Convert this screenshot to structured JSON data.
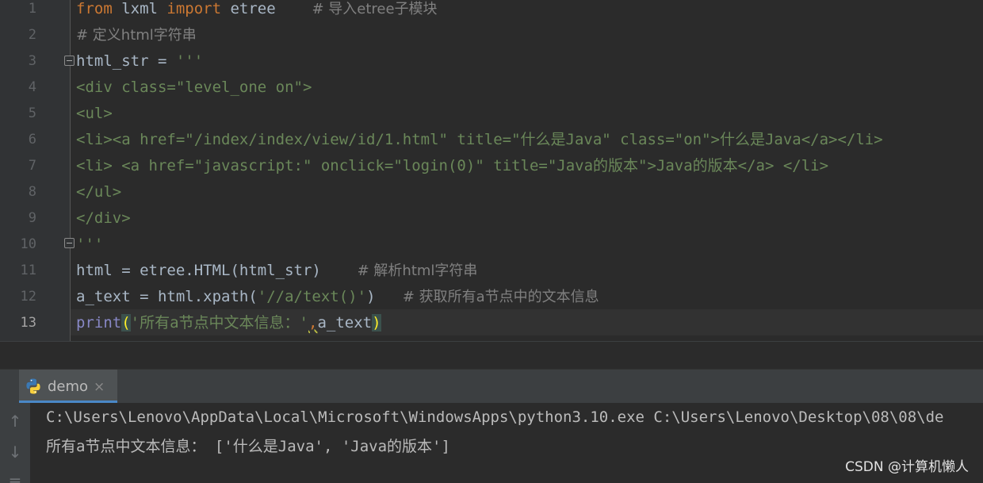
{
  "editor": {
    "line_numbers": [
      "1",
      "2",
      "3",
      "4",
      "5",
      "6",
      "7",
      "8",
      "9",
      "10",
      "11",
      "12",
      "13"
    ],
    "lines": [
      {
        "segments": [
          {
            "cls": "kw",
            "text": "from"
          },
          {
            "cls": "",
            "text": " lxml "
          },
          {
            "cls": "kw",
            "text": "import"
          },
          {
            "cls": "",
            "text": " etree    "
          },
          {
            "cls": "cmt",
            "text": "# 导入etree子模块"
          }
        ]
      },
      {
        "segments": [
          {
            "cls": "cmt",
            "text": "# 定义html字符串"
          }
        ]
      },
      {
        "segments": [
          {
            "cls": "",
            "text": "html_str = "
          },
          {
            "cls": "str",
            "text": "'''"
          }
        ]
      },
      {
        "segments": [
          {
            "cls": "str",
            "text": "<div class=\"level_one on\">"
          }
        ]
      },
      {
        "segments": [
          {
            "cls": "str",
            "text": "<ul>"
          }
        ]
      },
      {
        "segments": [
          {
            "cls": "str",
            "text": "<li><a href=\"/index/index/view/id/1.html\" title=\"什么是Java\" class=\"on\">什么是Java</a></li>"
          }
        ]
      },
      {
        "segments": [
          {
            "cls": "str",
            "text": "<li> <a href=\"javascript:\" onclick=\"login(0)\" title=\"Java的版本\">Java的版本</a> </li>"
          }
        ]
      },
      {
        "segments": [
          {
            "cls": "str",
            "text": "</ul>"
          }
        ]
      },
      {
        "segments": [
          {
            "cls": "str",
            "text": "</div>"
          }
        ]
      },
      {
        "segments": [
          {
            "cls": "str",
            "text": "'''"
          }
        ]
      },
      {
        "segments": [
          {
            "cls": "",
            "text": "html = etree.HTML(html_str)    "
          },
          {
            "cls": "cmt",
            "text": "# 解析html字符串"
          }
        ]
      },
      {
        "segments": [
          {
            "cls": "",
            "text": "a_text = html.xpath("
          },
          {
            "cls": "str",
            "text": "'//a/text()'"
          },
          {
            "cls": "",
            "text": ")   "
          },
          {
            "cls": "cmt",
            "text": "# 获取所有a节点中的文本信息"
          }
        ]
      },
      {
        "segments": [
          {
            "cls": "fn",
            "text": "print"
          },
          {
            "cls": "bracket",
            "text": "("
          },
          {
            "cls": "str",
            "text": "'所有a节点中文本信息：'"
          },
          {
            "cls": "squiggle",
            "text": ","
          },
          {
            "cls": "",
            "text": "a_text"
          },
          {
            "cls": "bracket",
            "text": ")"
          }
        ]
      }
    ],
    "current_line": "13"
  },
  "run_panel": {
    "tab_label": "demo",
    "close_glyph": "×",
    "python_icon": "python-icon",
    "toolbar": [
      {
        "name": "arrow-up-icon",
        "glyph": "↑"
      },
      {
        "name": "arrow-down-icon",
        "glyph": "↓"
      },
      {
        "name": "wrap-lines-icon",
        "glyph": "≡"
      }
    ],
    "console": [
      "C:\\Users\\Lenovo\\AppData\\Local\\Microsoft\\WindowsApps\\python3.10.exe C:\\Users\\Lenovo\\Desktop\\08\\08\\de",
      "所有a节点中文本信息： ['什么是Java', 'Java的版本']"
    ]
  },
  "watermark": "CSDN @计算机懒人",
  "colors": {
    "background": "#2b2b2b",
    "keyword": "#cc7832",
    "string": "#6a8759",
    "comment": "#808080",
    "builtin": "#8888c6",
    "tab_accent": "#4a88c7"
  }
}
